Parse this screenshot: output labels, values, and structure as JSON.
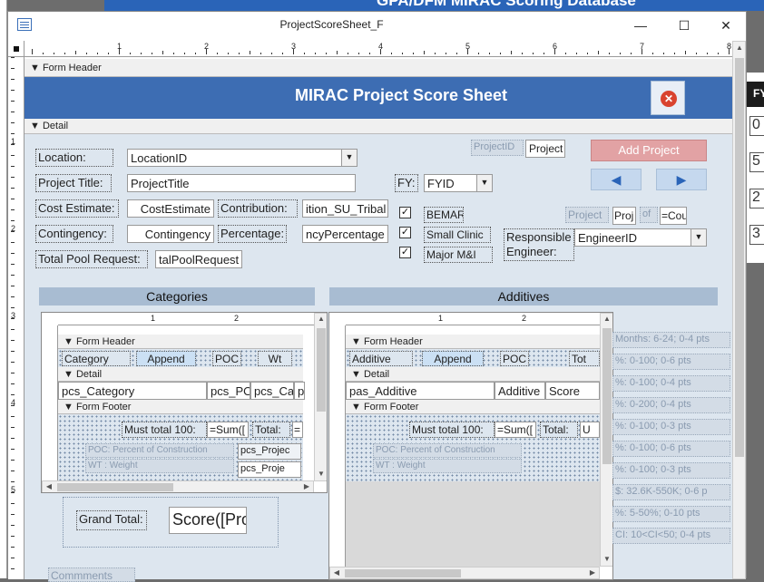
{
  "background": {
    "title_fragment": "GPA/DFM MIRAC Scoring Database",
    "right_column": {
      "label": "FY",
      "numbers": [
        "0",
        "5",
        "2",
        "3"
      ]
    }
  },
  "window": {
    "title": "ProjectScoreSheet_F",
    "controls": {
      "minimize": "—",
      "maximize": "☐",
      "close": "✕"
    }
  },
  "ruler": {
    "numbers": [
      "1",
      "2",
      "3",
      "4",
      "5",
      "6",
      "7",
      "8"
    ]
  },
  "vruler": {
    "numbers": [
      "1",
      "2",
      "3",
      "4",
      "5"
    ]
  },
  "sections": {
    "form_header": "Form Header",
    "detail": "Detail"
  },
  "header": {
    "title": "MIRAC Project Score Sheet",
    "close_icon": "⊗"
  },
  "detail": {
    "location_label": "Location:",
    "location_value": "LocationID",
    "project_title_label": "Project Title:",
    "project_title_value": "ProjectTitle",
    "fy_label": "FY:",
    "fy_value": "FYID",
    "cost_estimate_label": "Cost Estimate:",
    "cost_estimate_value": "CostEstimate",
    "contribution_label": "Contribution:",
    "contribution_value": "ition_SU_Tribal",
    "contingency_label": "Contingency:",
    "contingency_value": "Contingency",
    "percentage_label": "Percentage:",
    "percentage_value": "ncyPercentage",
    "total_pool_label": "Total Pool Request:",
    "total_pool_value": "talPoolRequest",
    "checkboxes": [
      {
        "label": "BEMAR",
        "checked": true
      },
      {
        "label": "Small Clinic",
        "checked": true
      },
      {
        "label": "Major M&I",
        "checked": true
      }
    ],
    "responsible_label": "Responsible Engineer:",
    "responsible_value": "EngineerID",
    "project_id_label": "ProjectID",
    "project_id_value": "Project",
    "add_project": "Add Project",
    "nav_prev": "◀",
    "nav_next": "▶",
    "project_count_label": "Project",
    "project_count_value": "Proj",
    "of_label": "of",
    "of_value": "=Cou",
    "categories_label": "Categories",
    "additives_label": "Additives",
    "grand_total_label": "Grand Total:",
    "grand_total_value": "Score([Pro",
    "comments_label": "Commments"
  },
  "sub_categories": {
    "ruler_numbers": [
      "1",
      "2"
    ],
    "form_header": "Form Header",
    "header_labels": [
      "Category",
      "Append",
      "POC",
      "Wt"
    ],
    "detail": "Detail",
    "detail_values": [
      "pcs_Category",
      "pcs_PO",
      "pcs_Cat",
      "p"
    ],
    "form_footer": "Form Footer",
    "must_total_label": "Must total 100:",
    "sum_value": "=Sum([",
    "total_label": "Total:",
    "total_value": "=",
    "poc_note": "POC: Percent of Construction",
    "wt_note": "WT : Weight",
    "projec1": "pcs_Projec",
    "projec2": "pcs_Proje"
  },
  "sub_additives": {
    "ruler_numbers": [
      "1",
      "2"
    ],
    "form_header": "Form Header",
    "header_labels": [
      "Additive",
      "Append",
      "POC",
      "Tot"
    ],
    "detail": "Detail",
    "detail_values": [
      "pas_Additive",
      "Additive",
      "Score"
    ],
    "form_footer": "Form Footer",
    "must_total_label": "Must total 100:",
    "sum_value": "=Sum([",
    "total_label": "Total:",
    "total_value": "U",
    "poc_note": "POC: Percent of Construction",
    "wt_note": "WT : Weight"
  },
  "criteria": [
    "Months: 6-24; 0-4 pts",
    "%: 0-100; 0-6 pts",
    "%: 0-100; 0-4 pts",
    "%: 0-200; 0-4 pts",
    "%: 0-100; 0-3 pts",
    "%: 0-100; 0-6 pts",
    "%: 0-100; 0-3 pts",
    "$: 32.6K-550K; 0-6 p",
    "%: 5-50%; 0-10 pts",
    "CI: 10<CI<50; 0-4 pts"
  ]
}
